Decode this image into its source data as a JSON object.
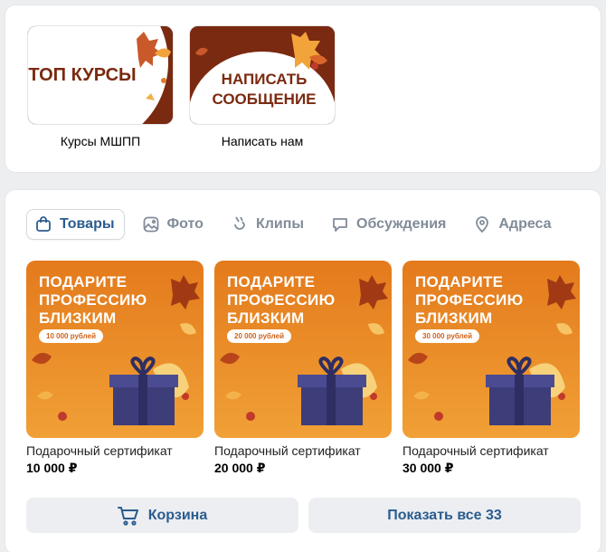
{
  "links": [
    {
      "thumb_text": "ТОП КУРСЫ",
      "caption": "Курсы МШПП"
    },
    {
      "thumb_text_1": "НАПИСАТЬ",
      "thumb_text_2": "СООБЩЕНИЕ",
      "caption": "Написать нам"
    }
  ],
  "tabs": [
    {
      "label": "Товары",
      "icon": "bag-icon",
      "active": true
    },
    {
      "label": "Фото",
      "icon": "photo-icon"
    },
    {
      "label": "Клипы",
      "icon": "clips-icon"
    },
    {
      "label": "Обсуждения",
      "icon": "discussion-icon"
    },
    {
      "label": "Адреса",
      "icon": "location-icon"
    }
  ],
  "products": [
    {
      "image_head_1": "ПОДАРИТЕ",
      "image_head_2": "ПРОФЕССИЮ",
      "image_head_3": "БЛИЗКИМ",
      "image_badge": "10 000 рублей",
      "title": "Подарочный сертификат",
      "price": "10 000 ₽"
    },
    {
      "image_head_1": "ПОДАРИТЕ",
      "image_head_2": "ПРОФЕССИЮ",
      "image_head_3": "БЛИЗКИМ",
      "image_badge": "20 000 рублей",
      "title": "Подарочный сертификат",
      "price": "20 000 ₽"
    },
    {
      "image_head_1": "ПОДАРИТЕ",
      "image_head_2": "ПРОФЕССИЮ",
      "image_head_3": "БЛИЗКИМ",
      "image_badge": "30 000 рублей",
      "title": "Подарочный сертификат",
      "price": "30 000 ₽"
    }
  ],
  "buttons": {
    "cart": "Корзина",
    "show_all": "Показать все 33"
  },
  "colors": {
    "accent": "#2b5c8e",
    "product_bg": "#e8801f",
    "thumb_bg": "#7a2a10"
  }
}
